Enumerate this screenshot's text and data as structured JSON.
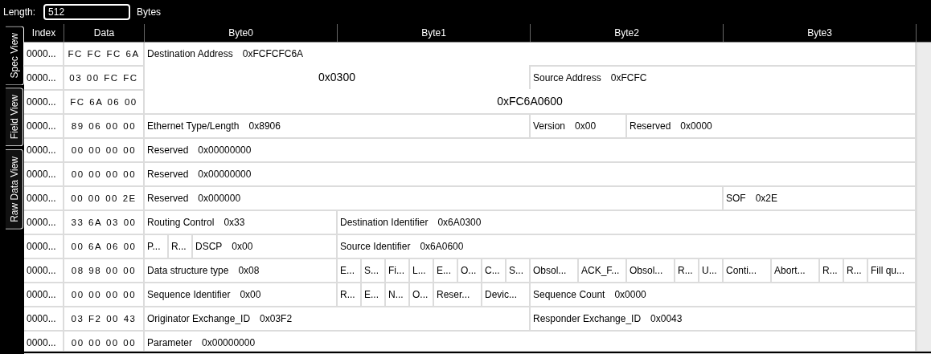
{
  "length_field": {
    "label": "Length:",
    "value": "512",
    "unit": "Bytes"
  },
  "tabs": [
    {
      "label": "Spec View",
      "selected": true
    },
    {
      "label": "Field View",
      "selected": false
    },
    {
      "label": "Raw Data View",
      "selected": false
    }
  ],
  "columns": [
    "Index",
    "Data",
    "Byte0",
    "Byte1",
    "Byte2",
    "Byte3"
  ],
  "rows": [
    {
      "index": "0000...",
      "data": "FC FC FC 6A",
      "fields": [
        {
          "kind": "field",
          "label": "Destination Address",
          "value": "0xFCFCFC6A"
        }
      ]
    },
    {
      "index": "0000...",
      "data": "03 00 FC FC",
      "fields": [
        {
          "kind": "continuation",
          "value": "0x0300"
        },
        {
          "kind": "field",
          "label": "Source Address",
          "value": "0xFCFC"
        }
      ]
    },
    {
      "index": "0000...",
      "data": "FC 6A 06 00",
      "fields": [
        {
          "kind": "continuation",
          "value": "0xFC6A0600"
        }
      ]
    },
    {
      "index": "0000...",
      "data": "89 06 00 00",
      "fields": [
        {
          "kind": "field",
          "label": "Ethernet Type/Length",
          "value": "0x8906"
        },
        {
          "kind": "field",
          "label": "Version",
          "value": "0x00"
        },
        {
          "kind": "field",
          "label": "Reserved",
          "value": "0x0000"
        }
      ]
    },
    {
      "index": "0000...",
      "data": "00 00 00 00",
      "fields": [
        {
          "kind": "field",
          "label": "Reserved",
          "value": "0x00000000"
        }
      ]
    },
    {
      "index": "0000...",
      "data": "00 00 00 00",
      "fields": [
        {
          "kind": "field",
          "label": "Reserved",
          "value": "0x00000000"
        }
      ]
    },
    {
      "index": "0000...",
      "data": "00 00 00 2E",
      "fields": [
        {
          "kind": "field",
          "label": "Reserved",
          "value": "0x000000"
        },
        {
          "kind": "field",
          "label": "SOF",
          "value": "0x2E"
        }
      ]
    },
    {
      "index": "0000...",
      "data": "33 6A 03 00",
      "fields": [
        {
          "kind": "field",
          "label": "Routing Control",
          "value": "0x33"
        },
        {
          "kind": "field",
          "label": "Destination Identifier",
          "value": "0x6A0300"
        }
      ]
    },
    {
      "index": "0000...",
      "data": "00 6A 06 00",
      "fields": [
        {
          "kind": "field",
          "label": "P..."
        },
        {
          "kind": "field",
          "label": "R..."
        },
        {
          "kind": "field",
          "label": "DSCP",
          "value": "0x00"
        },
        {
          "kind": "field",
          "label": "Source Identifier",
          "value": "0x6A0600"
        }
      ]
    },
    {
      "index": "0000...",
      "data": "08 98 00 00",
      "fields": [
        {
          "kind": "field",
          "label": "Data structure type",
          "value": "0x08"
        },
        {
          "kind": "field",
          "label": "E..."
        },
        {
          "kind": "field",
          "label": "S..."
        },
        {
          "kind": "field",
          "label": "Fi..."
        },
        {
          "kind": "field",
          "label": "L..."
        },
        {
          "kind": "field",
          "label": "E..."
        },
        {
          "kind": "field",
          "label": "O..."
        },
        {
          "kind": "field",
          "label": "C..."
        },
        {
          "kind": "field",
          "label": "S..."
        },
        {
          "kind": "field",
          "label": "Obsol..."
        },
        {
          "kind": "field",
          "label": "ACK_F..."
        },
        {
          "kind": "field",
          "label": "Obsol..."
        },
        {
          "kind": "field",
          "label": "R..."
        },
        {
          "kind": "field",
          "label": "U..."
        },
        {
          "kind": "field",
          "label": "Conti..."
        },
        {
          "kind": "field",
          "label": "Abort..."
        },
        {
          "kind": "field",
          "label": "R..."
        },
        {
          "kind": "field",
          "label": "R..."
        },
        {
          "kind": "field",
          "label": "Fill qu..."
        }
      ]
    },
    {
      "index": "0000...",
      "data": "00 00 00 00",
      "fields": [
        {
          "kind": "field",
          "label": "Sequence Identifier",
          "value": "0x00"
        },
        {
          "kind": "field",
          "label": "R..."
        },
        {
          "kind": "field",
          "label": "E..."
        },
        {
          "kind": "field",
          "label": "N..."
        },
        {
          "kind": "field",
          "label": "O..."
        },
        {
          "kind": "field",
          "label": "Reser..."
        },
        {
          "kind": "field",
          "label": "Devic..."
        },
        {
          "kind": "field",
          "label": "Sequence Count",
          "value": "0x0000"
        }
      ]
    },
    {
      "index": "0000...",
      "data": "03 F2 00 43",
      "fields": [
        {
          "kind": "field",
          "label": "Originator Exchange_ID",
          "value": "0x03F2"
        },
        {
          "kind": "field",
          "label": "Responder Exchange_ID",
          "value": "0x0043"
        }
      ]
    },
    {
      "index": "0000...",
      "data": "00 00 00 00",
      "fields": [
        {
          "kind": "field",
          "label": "Parameter",
          "value": "0x00000000"
        }
      ]
    }
  ]
}
